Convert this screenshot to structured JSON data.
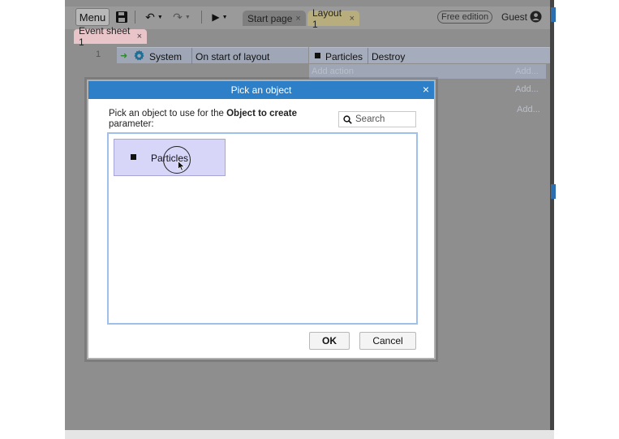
{
  "toolbar": {
    "menu_label": "Menu",
    "tabs": [
      {
        "label": "Start page",
        "close": "×"
      },
      {
        "label": "Layout 1",
        "close": "×"
      }
    ],
    "edition_badge": "Free edition",
    "user_label": "Guest"
  },
  "event_sheet": {
    "tab_label": "Event sheet 1",
    "tab_close": "×",
    "rows": [
      {
        "number": "1",
        "condition_object": "System",
        "condition": "On start of layout",
        "action_object": "Particles",
        "action": "Destroy"
      }
    ],
    "add_action": "Add action",
    "add_links": [
      "Add...",
      "Add...",
      "Add..."
    ]
  },
  "dialog": {
    "title": "Pick an object",
    "close": "×",
    "prompt_prefix": "Pick an object to use for the ",
    "prompt_bold": "Object to create",
    "prompt_suffix": " parameter:",
    "search_placeholder": "Search",
    "objects": [
      {
        "name": "Particles"
      }
    ],
    "ok_label": "OK",
    "cancel_label": "Cancel"
  },
  "colors": {
    "titlebar": "#2d80c8",
    "selection": "#d7d6f8",
    "list_border": "#9fc0ea"
  }
}
